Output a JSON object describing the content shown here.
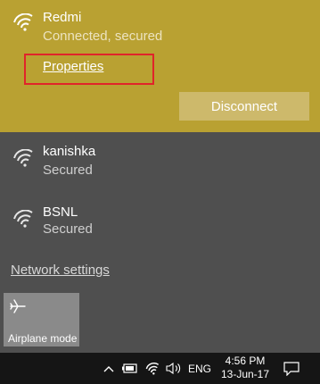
{
  "connected": {
    "name": "Redmi",
    "status": "Connected, secured",
    "properties_label": "Properties",
    "disconnect_label": "Disconnect"
  },
  "networks": [
    {
      "name": "kanishka",
      "status": "Secured"
    },
    {
      "name": "BSNL",
      "status": "Secured"
    }
  ],
  "network_settings_label": "Network settings",
  "quick_actions": {
    "airplane_label": "Airplane mode"
  },
  "taskbar": {
    "language": "ENG",
    "time": "4:56 PM",
    "date": "13-Jun-17"
  },
  "colors": {
    "accent": "#b9a132",
    "highlight_box": "#e0242a",
    "flyout_bg": "#4f4f4f",
    "taskbar_bg": "#151515"
  }
}
